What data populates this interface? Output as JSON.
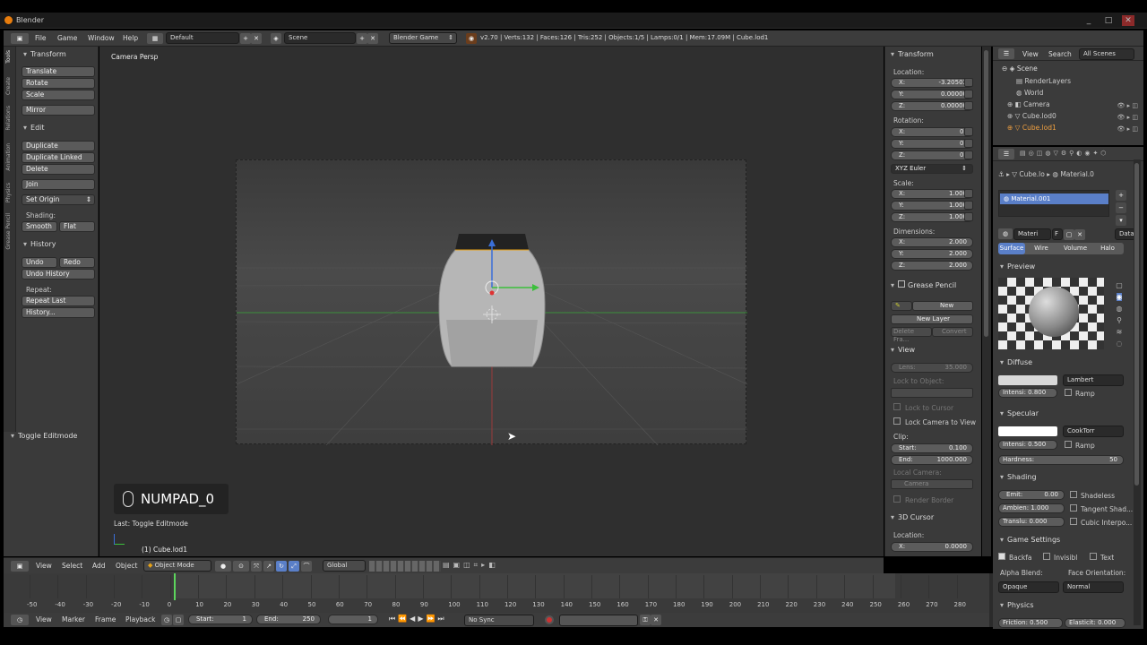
{
  "titlebar": {
    "title": "Blender"
  },
  "info": {
    "menus": [
      "File",
      "Game",
      "Window",
      "Help"
    ],
    "layout": "Default",
    "scene": "Scene",
    "engine": "Blender Game",
    "stats": "v2.70 | Verts:132 | Faces:126 | Tris:252 | Objects:1/5 | Lamps:0/1 | Mem:17.09M | Cube.lod1"
  },
  "toolshelf": {
    "tabs": [
      "Tools",
      "Create",
      "Relations",
      "Animation",
      "Physics",
      "Grease Pencil"
    ],
    "transform_title": "Transform",
    "translate": "Translate",
    "rotate": "Rotate",
    "scale": "Scale",
    "mirror": "Mirror",
    "edit_title": "Edit",
    "duplicate": "Duplicate",
    "duplicate_linked": "Duplicate Linked",
    "delete": "Delete",
    "join": "Join",
    "set_origin": "Set Origin",
    "shading_label": "Shading:",
    "smooth": "Smooth",
    "flat": "Flat",
    "history_title": "History",
    "undo": "Undo",
    "redo": "Redo",
    "undo_history": "Undo History",
    "repeat_label": "Repeat:",
    "repeat_last": "Repeat Last",
    "history": "History...",
    "operator_title": "Toggle Editmode"
  },
  "viewport": {
    "view_name": "Camera Persp",
    "key_label": "NUMPAD_0",
    "last_op": "Last: Toggle Editmode",
    "object_name": "(1) Cube.lod1"
  },
  "npanel": {
    "transform_title": "Transform",
    "location_label": "Location:",
    "loc": [
      {
        "k": "X:",
        "v": "-3.20503"
      },
      {
        "k": "Y:",
        "v": "0.00000"
      },
      {
        "k": "Z:",
        "v": "0.00000"
      }
    ],
    "rotation_label": "Rotation:",
    "rot": [
      {
        "k": "X:",
        "v": "0°"
      },
      {
        "k": "Y:",
        "v": "0°"
      },
      {
        "k": "Z:",
        "v": "0°"
      }
    ],
    "rot_mode": "XYZ Euler",
    "scale_label": "Scale:",
    "scale": [
      {
        "k": "X:",
        "v": "1.000"
      },
      {
        "k": "Y:",
        "v": "1.000"
      },
      {
        "k": "Z:",
        "v": "1.000"
      }
    ],
    "dims_label": "Dimensions:",
    "dims": [
      {
        "k": "X:",
        "v": "2.000"
      },
      {
        "k": "Y:",
        "v": "2.000"
      },
      {
        "k": "Z:",
        "v": "2.000"
      }
    ],
    "gp_title": "Grease Pencil",
    "gp_new": "New",
    "gp_new_layer": "New Layer",
    "gp_delete": "Delete Fra...",
    "gp_convert": "Convert",
    "view_title": "View",
    "lens_k": "Lens:",
    "lens_v": "35.000",
    "lock_obj": "Lock to Object:",
    "lock_cursor": "Lock to Cursor",
    "lock_cam": "Lock Camera to View",
    "clip_label": "Clip:",
    "clip_start_k": "Start:",
    "clip_start_v": "0.100",
    "clip_end_k": "End:",
    "clip_end_v": "1000.000",
    "local_cam": "Local Camera:",
    "camera": "Camera",
    "render_border": "Render Border",
    "cursor_title": "3D Cursor",
    "cursor_loc_label": "Location:",
    "cursor_x_k": "X:",
    "cursor_x_v": "0.0000"
  },
  "outliner": {
    "view": "View",
    "search": "Search",
    "filter": "All Scenes",
    "items": [
      "Scene",
      "RenderLayers",
      "World",
      "Camera",
      "Cube.lod0",
      "Cube.lod1"
    ]
  },
  "properties": {
    "context_obj": "Cube.lo",
    "context_mat": "Material.0",
    "material_slot": "Material.001",
    "mat_name": "Materi",
    "mat_f": "F",
    "mat_data": "Data",
    "tabs": [
      "Surface",
      "Wire",
      "Volume",
      "Halo"
    ],
    "preview_title": "Preview",
    "diffuse_title": "Diffuse",
    "diffuse_shader": "Lambert",
    "diffuse_intensity": "Intensi: 0.800",
    "ramp": "Ramp",
    "specular_title": "Specular",
    "spec_shader": "CookTorr",
    "spec_intensity": "Intensi: 0.500",
    "hardness": "Hardness:",
    "hardness_v": "50",
    "shading_title": "Shading",
    "emit": "Emit:",
    "emit_v": "0.00",
    "ambient": "Ambien: 1.000",
    "transl": "Translu: 0.000",
    "shadeless": "Shadeless",
    "tangent": "Tangent Shad...",
    "cubic": "Cubic Interpo...",
    "game_title": "Game Settings",
    "backface": "Backfa",
    "invisible": "Invisibl",
    "text": "Text",
    "alpha_label": "Alpha Blend:",
    "face_label": "Face Orientation:",
    "alpha": "Opaque",
    "face": "Normal",
    "physics_title": "Physics",
    "friction": "Friction: 0.500",
    "elasticity": "Elasticit: 0.000"
  },
  "view3d_header": {
    "menus": [
      "View",
      "Select",
      "Add",
      "Object"
    ],
    "mode": "Object Mode",
    "orientation": "Global"
  },
  "timeline": {
    "ticks": [
      "-50",
      "-40",
      "-30",
      "-20",
      "-10",
      "0",
      "10",
      "20",
      "30",
      "40",
      "50",
      "60",
      "70",
      "80",
      "90",
      "100",
      "110",
      "120",
      "130",
      "140",
      "150",
      "160",
      "170",
      "180",
      "190",
      "200",
      "210",
      "220",
      "230",
      "240",
      "250",
      "260",
      "270",
      "280"
    ],
    "current_frame_value": 1,
    "menus": [
      "View",
      "Marker",
      "Frame",
      "Playback"
    ],
    "start": "Start:",
    "start_v": "1",
    "end": "End:",
    "end_v": "250",
    "frame_v": "1",
    "sync": "No Sync"
  }
}
